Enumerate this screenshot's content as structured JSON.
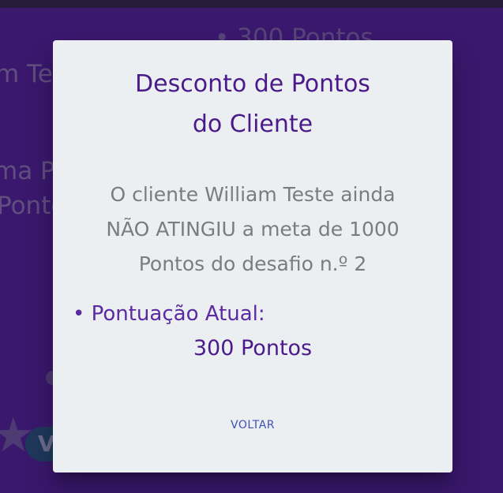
{
  "background": {
    "top_points": "• 300 Pontos",
    "client_name_fragment": "m Te",
    "line1_fragment": "ma P",
    "line2_fragment": "Ponte",
    "pill_label": "V"
  },
  "dialog": {
    "title_line1": "Desconto de Pontos",
    "title_line2": "do Cliente",
    "message_line1": "O cliente William Teste ainda",
    "message_line2": "NÃO ATINGIU a meta de 1000",
    "message_line3": "Pontos do desafio n.º 2",
    "score_label": "• Pontuação Atual:",
    "score_value": "300 Pontos",
    "back_label": "VOLTAR"
  }
}
